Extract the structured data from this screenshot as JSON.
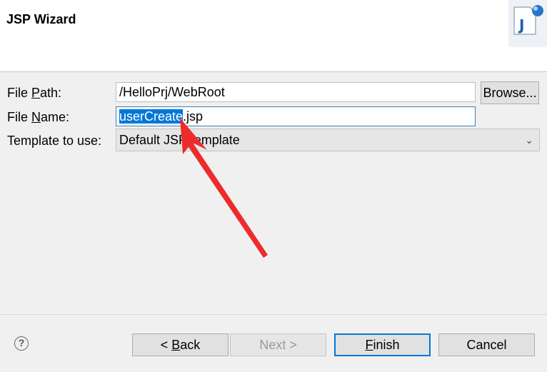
{
  "header": {
    "title": "JSP Wizard",
    "icon": "jsp-file-icon"
  },
  "form": {
    "file_path": {
      "label_pre": "File ",
      "label_mnemonic": "P",
      "label_post": "ath:",
      "value": "/HelloPrj/WebRoot"
    },
    "browse_label": "Browse...",
    "file_name": {
      "label_pre": "File ",
      "label_mnemonic": "N",
      "label_post": "ame:",
      "value_selected": "userCreate",
      "value_rest": ".jsp"
    },
    "template": {
      "label": "Template to use:",
      "selected": "Default JSP template"
    }
  },
  "footer": {
    "help_icon": "help-icon",
    "back_mnemonic": "B",
    "back_pre": "< ",
    "back_post": "ack",
    "next_label": "Next >",
    "finish_mnemonic": "F",
    "finish_post": "inish",
    "cancel_label": "Cancel"
  },
  "colors": {
    "selection": "#0078d7",
    "annotation_arrow": "#ee2b2b",
    "focus_border": "#0078d7"
  }
}
